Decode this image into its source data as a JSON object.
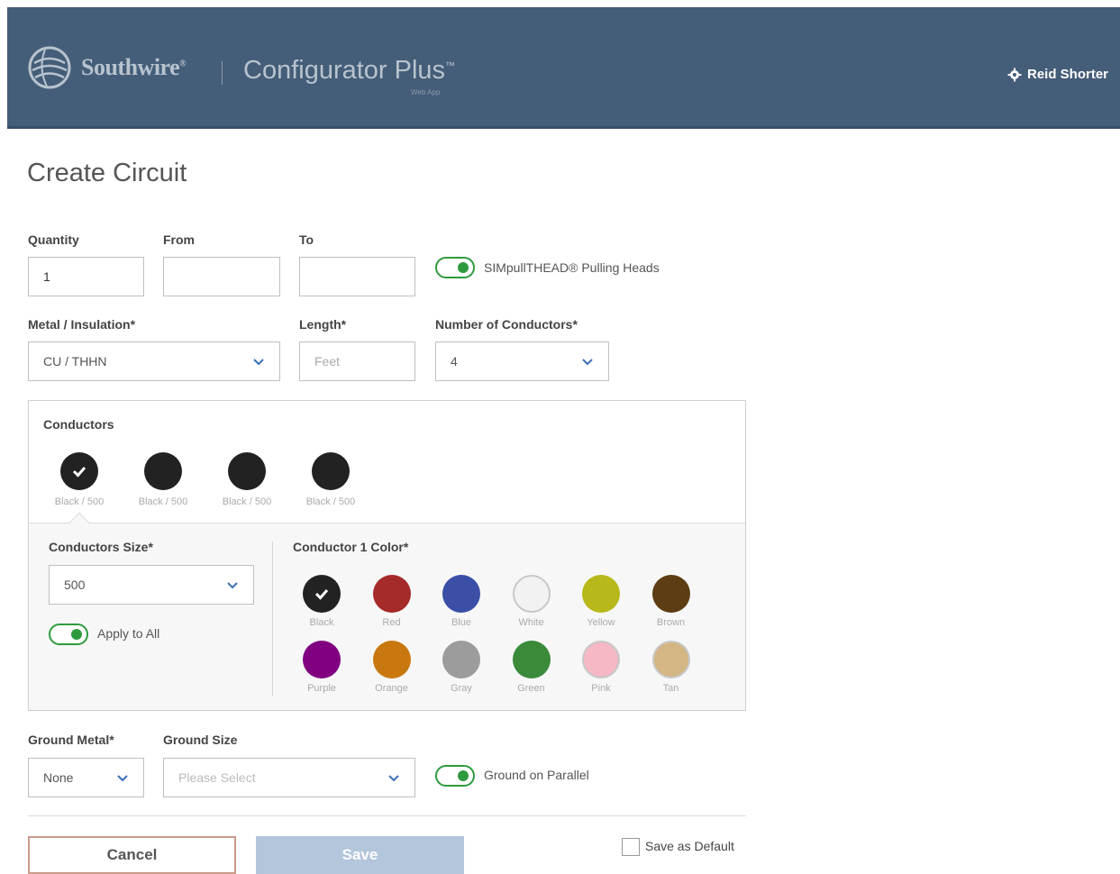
{
  "header": {
    "brand": "Southwire",
    "app_title": "Configurator Plus",
    "app_subtitle": "Web App",
    "user_name": "Reid Shorter",
    "icons": {
      "logo": "southwire-globe-logo",
      "user": "gear-icon"
    },
    "color": "#445d78"
  },
  "page": {
    "title": "Create Circuit"
  },
  "form": {
    "quantity": {
      "label": "Quantity",
      "value": "1"
    },
    "from": {
      "label": "From",
      "value": ""
    },
    "to": {
      "label": "To",
      "value": ""
    },
    "pulling_heads": {
      "label": "SIMpullTHEAD® Pulling Heads",
      "on": true
    },
    "metal_insulation": {
      "label": "Metal / Insulation*",
      "value": "CU / THHN"
    },
    "length": {
      "label": "Length*",
      "placeholder": "Feet"
    },
    "num_conductors": {
      "label": "Number of Conductors*",
      "value": "4"
    }
  },
  "conductors": {
    "title": "Conductors",
    "items": [
      {
        "caption": "Black / 500",
        "color": "#222222",
        "selected": true
      },
      {
        "caption": "Black / 500",
        "color": "#222222",
        "selected": false
      },
      {
        "caption": "Black / 500",
        "color": "#222222",
        "selected": false
      },
      {
        "caption": "Black / 500",
        "color": "#222222",
        "selected": false
      }
    ],
    "size": {
      "label": "Conductors Size*",
      "value": "500"
    },
    "apply_all": {
      "label": "Apply to All",
      "on": true
    },
    "color_title": "Conductor 1 Color*",
    "colors": [
      {
        "name": "Black",
        "hex": "#222222",
        "selected": true
      },
      {
        "name": "Red",
        "hex": "#a52a2a",
        "selected": false
      },
      {
        "name": "Blue",
        "hex": "#3b4fa6",
        "selected": false
      },
      {
        "name": "White",
        "hex": "#f2f2f2",
        "selected": false
      },
      {
        "name": "Yellow",
        "hex": "#b8b81a",
        "selected": false
      },
      {
        "name": "Brown",
        "hex": "#5c3d14",
        "selected": false
      },
      {
        "name": "Purple",
        "hex": "#800080",
        "selected": false
      },
      {
        "name": "Orange",
        "hex": "#c8780f",
        "selected": false
      },
      {
        "name": "Gray",
        "hex": "#9c9c9c",
        "selected": false
      },
      {
        "name": "Green",
        "hex": "#3a8a3a",
        "selected": false
      },
      {
        "name": "Pink",
        "hex": "#f5b8c4",
        "selected": false
      },
      {
        "name": "Tan",
        "hex": "#d3b683",
        "selected": false
      }
    ]
  },
  "ground": {
    "metal": {
      "label": "Ground Metal*",
      "value": "None"
    },
    "size": {
      "label": "Ground Size",
      "placeholder": "Please Select"
    },
    "parallel": {
      "label": "Ground on Parallel",
      "on": true
    }
  },
  "actions": {
    "cancel": "Cancel",
    "save": "Save",
    "save_default": "Save as Default"
  }
}
